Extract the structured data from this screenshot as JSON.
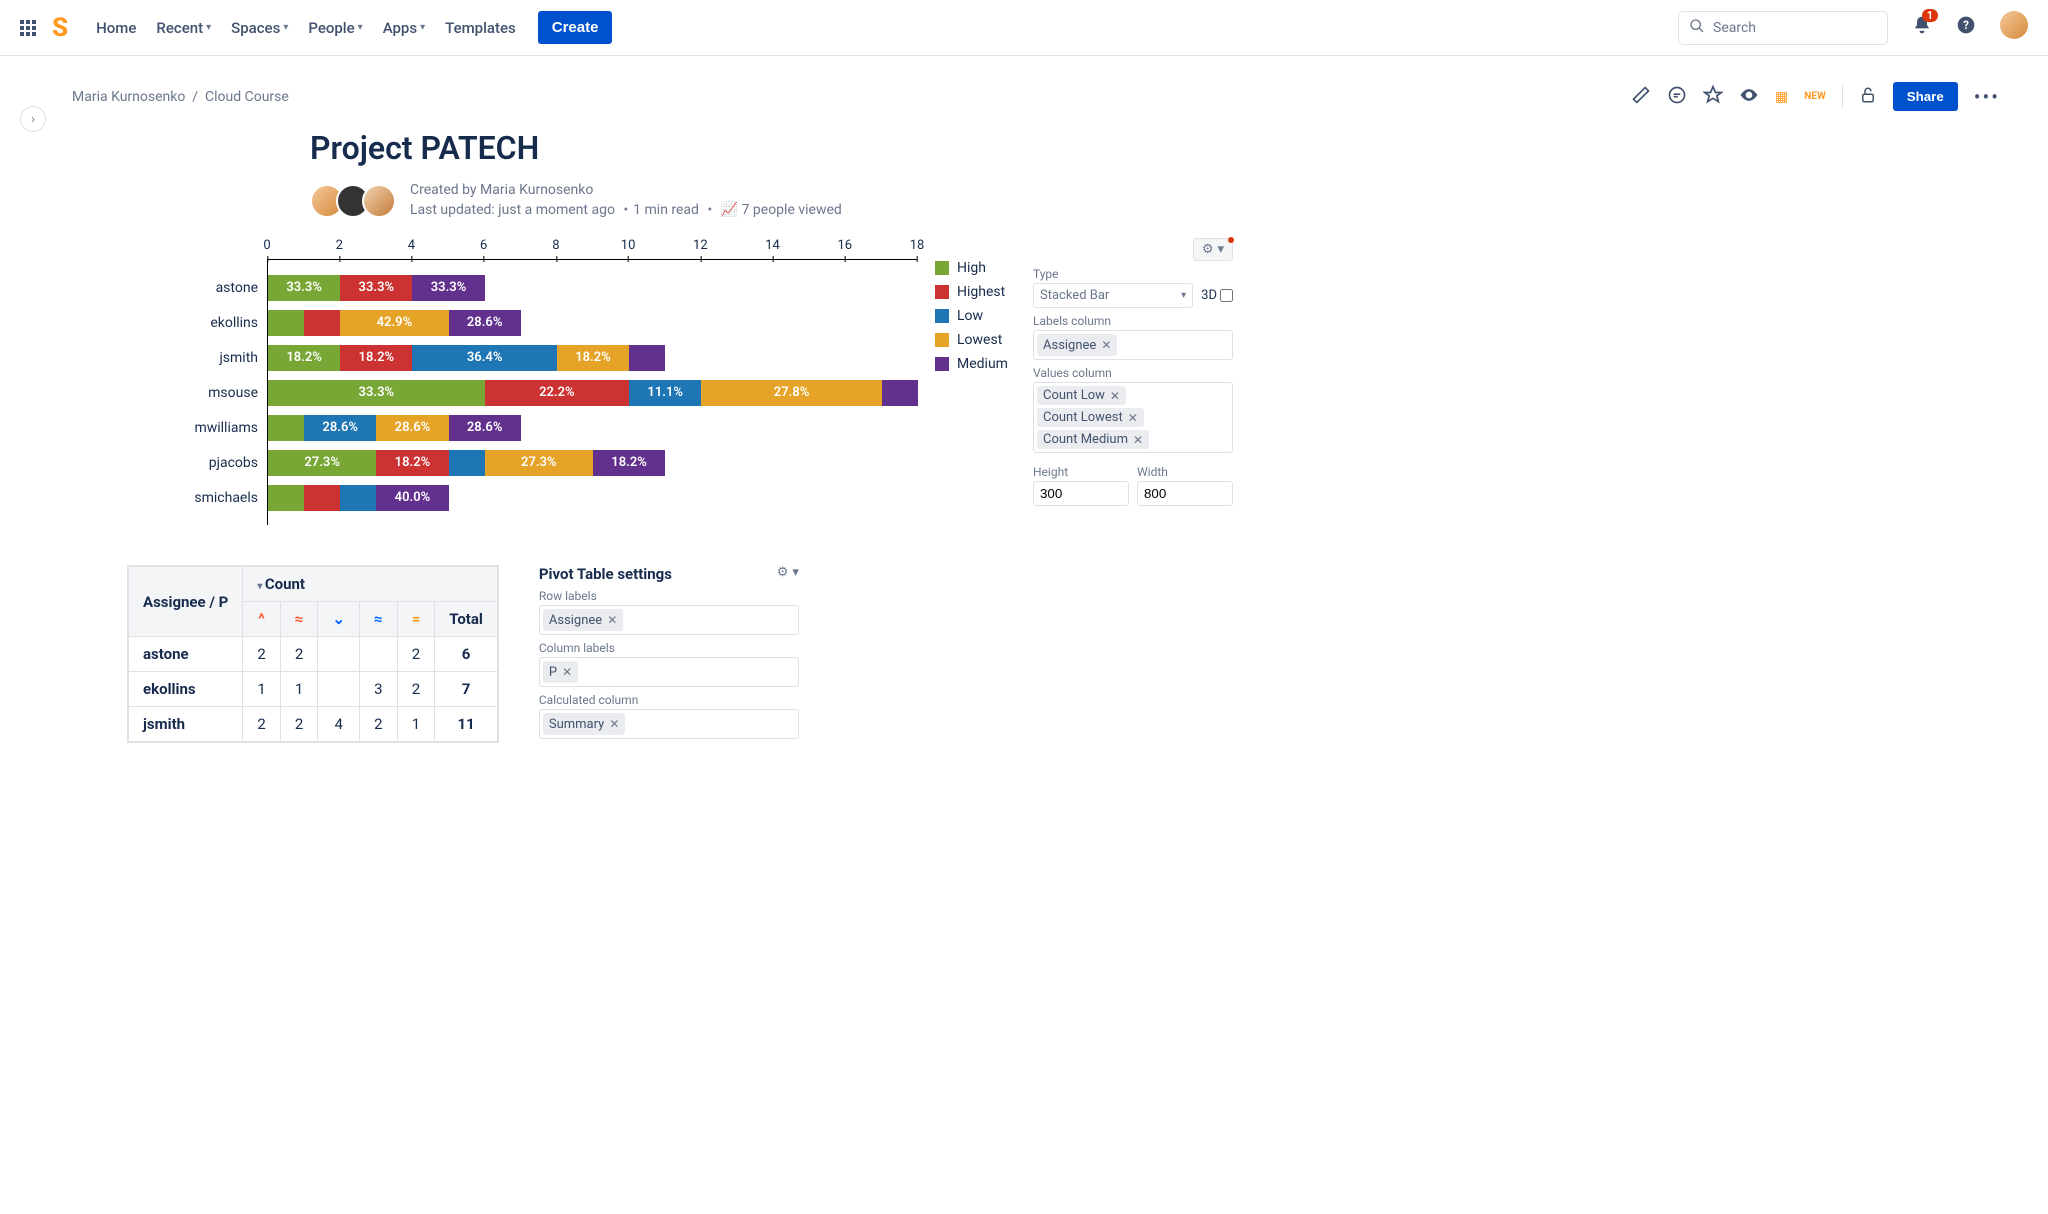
{
  "nav": {
    "home": "Home",
    "recent": "Recent",
    "spaces": "Spaces",
    "people": "People",
    "apps": "Apps",
    "templates": "Templates",
    "create": "Create",
    "search_placeholder": "Search",
    "notif_count": "1"
  },
  "breadcrumb": {
    "space": "Maria Kurnosenko",
    "page": "Cloud Course"
  },
  "actions": {
    "share": "Share"
  },
  "page": {
    "title": "Project PATECH",
    "created_by_label": "Created by ",
    "created_by": "Maria Kurnosenko",
    "last_updated_label": "Last updated: ",
    "last_updated": "just a moment ago",
    "read_time": "1 min read",
    "views": "7 people viewed"
  },
  "chart_data": {
    "type": "bar",
    "orientation": "horizontal-stacked",
    "x_axis": {
      "min": 0,
      "max": 18,
      "step": 2
    },
    "categories": [
      "astone",
      "ekollins",
      "jsmith",
      "msouse",
      "mwilliams",
      "pjacobs",
      "smichaels"
    ],
    "legend": [
      {
        "key": "high",
        "label": "High",
        "color": "#79A736"
      },
      {
        "key": "highest",
        "label": "Highest",
        "color": "#CC3232"
      },
      {
        "key": "low",
        "label": "Low",
        "color": "#1E77B4"
      },
      {
        "key": "lowest",
        "label": "Lowest",
        "color": "#E5A428"
      },
      {
        "key": "medium",
        "label": "Medium",
        "color": "#62318E"
      }
    ],
    "rows": [
      {
        "name": "astone",
        "total": 6,
        "segments": [
          {
            "k": "high",
            "v": 2,
            "pct": "33.3%"
          },
          {
            "k": "highest",
            "v": 2,
            "pct": "33.3%"
          },
          {
            "k": "medium",
            "v": 2,
            "pct": "33.3%"
          }
        ]
      },
      {
        "name": "ekollins",
        "total": 7,
        "segments": [
          {
            "k": "high",
            "v": 1,
            "pct": ""
          },
          {
            "k": "highest",
            "v": 1,
            "pct": ""
          },
          {
            "k": "lowest",
            "v": 3,
            "pct": "42.9%"
          },
          {
            "k": "medium",
            "v": 2,
            "pct": "28.6%"
          }
        ]
      },
      {
        "name": "jsmith",
        "total": 11,
        "segments": [
          {
            "k": "high",
            "v": 2,
            "pct": "18.2%"
          },
          {
            "k": "highest",
            "v": 2,
            "pct": "18.2%"
          },
          {
            "k": "low",
            "v": 4,
            "pct": "36.4%"
          },
          {
            "k": "lowest",
            "v": 2,
            "pct": "18.2%"
          },
          {
            "k": "medium",
            "v": 1,
            "pct": ""
          }
        ]
      },
      {
        "name": "msouse",
        "total": 18,
        "segments": [
          {
            "k": "high",
            "v": 6,
            "pct": "33.3%"
          },
          {
            "k": "highest",
            "v": 4,
            "pct": "22.2%"
          },
          {
            "k": "low",
            "v": 2,
            "pct": "11.1%"
          },
          {
            "k": "lowest",
            "v": 5,
            "pct": "27.8%"
          },
          {
            "k": "medium",
            "v": 1,
            "pct": ""
          }
        ]
      },
      {
        "name": "mwilliams",
        "total": 7,
        "segments": [
          {
            "k": "high",
            "v": 1,
            "pct": ""
          },
          {
            "k": "low",
            "v": 2,
            "pct": "28.6%"
          },
          {
            "k": "lowest",
            "v": 2,
            "pct": "28.6%"
          },
          {
            "k": "medium",
            "v": 2,
            "pct": "28.6%"
          }
        ]
      },
      {
        "name": "pjacobs",
        "total": 11,
        "segments": [
          {
            "k": "high",
            "v": 3,
            "pct": "27.3%"
          },
          {
            "k": "highest",
            "v": 2,
            "pct": "18.2%"
          },
          {
            "k": "low",
            "v": 1,
            "pct": ""
          },
          {
            "k": "lowest",
            "v": 3,
            "pct": "27.3%"
          },
          {
            "k": "medium",
            "v": 2,
            "pct": "18.2%"
          }
        ]
      },
      {
        "name": "smichaels",
        "total": 5,
        "segments": [
          {
            "k": "high",
            "v": 1,
            "pct": ""
          },
          {
            "k": "highest",
            "v": 1,
            "pct": ""
          },
          {
            "k": "low",
            "v": 1,
            "pct": ""
          },
          {
            "k": "medium",
            "v": 2,
            "pct": "40.0%"
          }
        ]
      }
    ]
  },
  "chart_cfg": {
    "type_label": "Type",
    "type_value": "Stacked Bar",
    "three_d": "3D",
    "labels_col": "Labels column",
    "labels_tag": "Assignee",
    "values_col": "Values column",
    "values_tags": [
      "Count Low",
      "Count Lowest",
      "Count Medium"
    ],
    "height_label": "Height",
    "height": "300",
    "width_label": "Width",
    "width": "800"
  },
  "pivot": {
    "corner": "Assignee / P",
    "count_header": "Count",
    "total_header": "Total",
    "priority_cols": [
      "high",
      "highest",
      "low",
      "lowest",
      "medium"
    ],
    "rows": [
      {
        "name": "astone",
        "cells": [
          "2",
          "2",
          "",
          "",
          "2"
        ],
        "total": "6"
      },
      {
        "name": "ekollins",
        "cells": [
          "1",
          "1",
          "",
          "3",
          "2"
        ],
        "total": "7"
      },
      {
        "name": "jsmith",
        "cells": [
          "2",
          "2",
          "4",
          "2",
          "1"
        ],
        "total": "11"
      }
    ]
  },
  "pivot_cfg": {
    "title": "Pivot Table settings",
    "row_labels": "Row labels",
    "row_tag": "Assignee",
    "col_labels": "Column labels",
    "col_tag": "P",
    "calc_col": "Calculated column",
    "calc_tag": "Summary"
  }
}
